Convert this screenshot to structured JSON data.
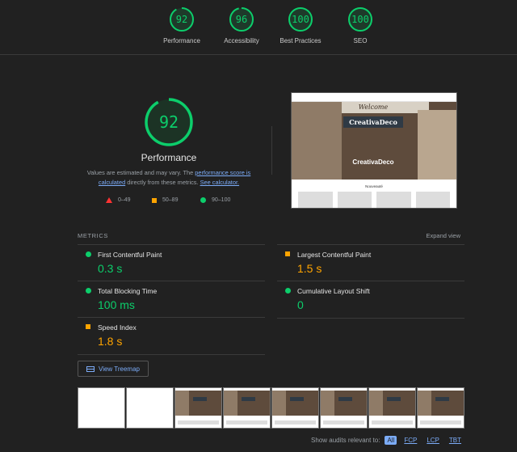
{
  "categories": [
    {
      "score": "92",
      "label": "Performance",
      "fraction": 0.92
    },
    {
      "score": "96",
      "label": "Accessibility",
      "fraction": 0.96
    },
    {
      "score": "100",
      "label": "Best Practices",
      "fraction": 1.0
    },
    {
      "score": "100",
      "label": "SEO",
      "fraction": 1.0
    }
  ],
  "performance": {
    "score": "92",
    "fraction": 0.92,
    "title": "Performance",
    "desc_part1": "Values are estimated and may vary. The ",
    "desc_link1": "performance score is calculated",
    "desc_part2": " directly from these metrics. ",
    "desc_link2": "See calculator."
  },
  "legend": {
    "fail": "0–49",
    "average": "50–89",
    "pass": "90–100"
  },
  "screenshot": {
    "welcome": "Welcome",
    "sign": "CreativaDeco",
    "brand": "CreativaDeco",
    "section": "Nouveauté"
  },
  "metrics": {
    "heading": "METRICS",
    "expand_label": "Expand view",
    "items": [
      {
        "name": "First Contentful Paint",
        "value": "0.3 s",
        "status": "pass"
      },
      {
        "name": "Largest Contentful Paint",
        "value": "1.5 s",
        "status": "average"
      },
      {
        "name": "Total Blocking Time",
        "value": "100 ms",
        "status": "pass"
      },
      {
        "name": "Cumulative Layout Shift",
        "value": "0",
        "status": "pass"
      },
      {
        "name": "Speed Index",
        "value": "1.8 s",
        "status": "average"
      }
    ]
  },
  "treemap_label": "View Treemap",
  "audits": {
    "label": "Show audits relevant to:",
    "filters": [
      "All",
      "FCP",
      "LCP",
      "TBT"
    ]
  },
  "colors": {
    "pass": "#0cce6b",
    "average": "#ffa400",
    "fail": "#ff3333",
    "link": "#7cacf8",
    "background": "#212121"
  }
}
